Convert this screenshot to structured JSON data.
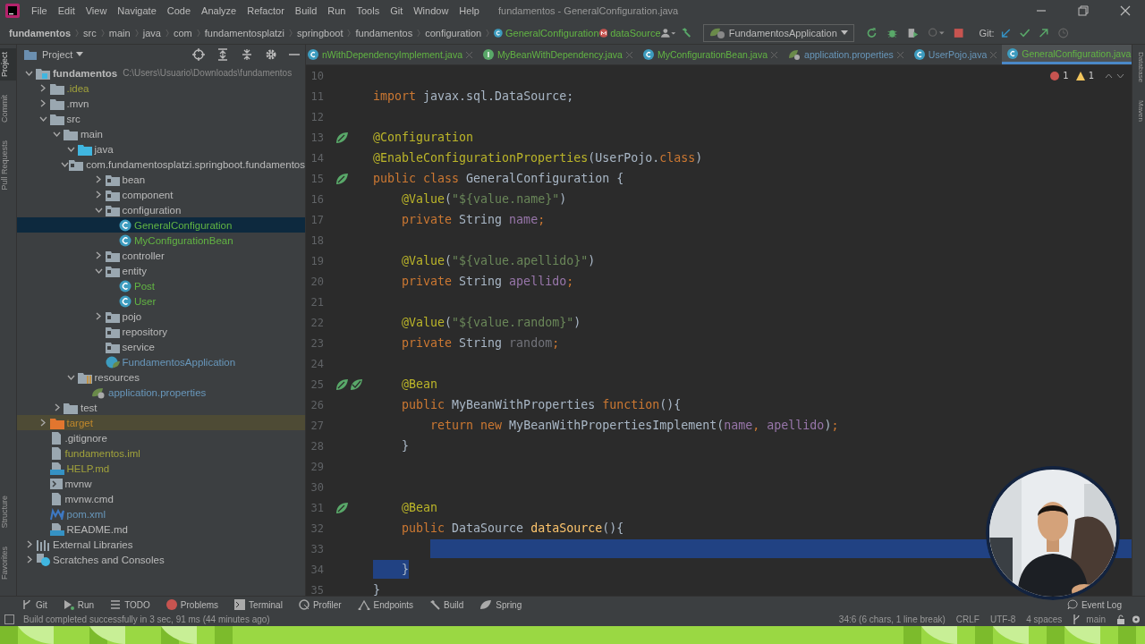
{
  "menu": [
    "File",
    "Edit",
    "View",
    "Navigate",
    "Code",
    "Analyze",
    "Refactor",
    "Build",
    "Run",
    "Tools",
    "Git",
    "Window",
    "Help"
  ],
  "window": {
    "title": "fundamentos - GeneralConfiguration.java"
  },
  "breadcrumbs": [
    {
      "label": "fundamentos",
      "kind": "root"
    },
    {
      "label": "src",
      "kind": "folder"
    },
    {
      "label": "main",
      "kind": "folder"
    },
    {
      "label": "java",
      "kind": "folder"
    },
    {
      "label": "com",
      "kind": "folder"
    },
    {
      "label": "fundamentosplatzi",
      "kind": "folder"
    },
    {
      "label": "springboot",
      "kind": "folder"
    },
    {
      "label": "fundamentos",
      "kind": "folder"
    },
    {
      "label": "configuration",
      "kind": "folder"
    },
    {
      "label": "GeneralConfiguration",
      "kind": "class"
    },
    {
      "label": "dataSource",
      "kind": "method"
    }
  ],
  "run_config": {
    "label": "FundamentosApplication"
  },
  "vcs_label": "Git:",
  "tool_strip_left": [
    {
      "label": "Project",
      "selected": true
    },
    {
      "label": "Commit",
      "selected": false
    },
    {
      "label": "Pull Requests",
      "selected": false
    }
  ],
  "tool_strip_left_bottom": [
    {
      "label": "Structure",
      "selected": false
    },
    {
      "label": "Favorites",
      "selected": false
    }
  ],
  "tool_strip_right": [
    {
      "label": "Database",
      "selected": false
    },
    {
      "label": "Maven",
      "selected": false
    }
  ],
  "project_panel": {
    "title": "Project"
  },
  "tree": [
    {
      "label": "fundamentos",
      "path": "C:\\Users\\Usuario\\Downloads\\fundamentos",
      "kind": "module",
      "color": "#bbbbbb",
      "expanded": true,
      "selected": false,
      "children": [
        {
          "label": ".idea",
          "kind": "folder",
          "color": "#a1a23b",
          "expanded": false,
          "selected": false
        },
        {
          "label": ".mvn",
          "kind": "folder",
          "color": "#bbbbbb",
          "expanded": false,
          "selected": false
        },
        {
          "label": "src",
          "kind": "folder",
          "color": "#bbbbbb",
          "expanded": true,
          "selected": false,
          "children": [
            {
              "label": "main",
              "kind": "folder",
              "color": "#bbbbbb",
              "expanded": true,
              "selected": false,
              "children": [
                {
                  "label": "java",
                  "kind": "source",
                  "color": "#bbbbbb",
                  "expanded": true,
                  "selected": false,
                  "children": [
                    {
                      "label": "com.fundamentosplatzi.springboot.fundamentos",
                      "kind": "package",
                      "color": "#bbbbbb",
                      "expanded": true,
                      "selected": false,
                      "children": [
                        {
                          "label": "bean",
                          "kind": "package",
                          "color": "#bbbbbb",
                          "expanded": false,
                          "selected": false
                        },
                        {
                          "label": "component",
                          "kind": "package",
                          "color": "#bbbbbb",
                          "expanded": false,
                          "selected": false
                        },
                        {
                          "label": "configuration",
                          "kind": "package",
                          "color": "#bbbbbb",
                          "expanded": true,
                          "selected": false,
                          "children": [
                            {
                              "label": "GeneralConfiguration",
                              "kind": "class",
                              "color": "#62b543",
                              "selected": true
                            },
                            {
                              "label": "MyConfigurationBean",
                              "kind": "class",
                              "color": "#62b543",
                              "selected": false
                            }
                          ]
                        },
                        {
                          "label": "controller",
                          "kind": "package",
                          "color": "#bbbbbb",
                          "expanded": false,
                          "selected": false
                        },
                        {
                          "label": "entity",
                          "kind": "package",
                          "color": "#bbbbbb",
                          "expanded": true,
                          "selected": false,
                          "children": [
                            {
                              "label": "Post",
                              "kind": "class",
                              "color": "#62b543",
                              "selected": false
                            },
                            {
                              "label": "User",
                              "kind": "class",
                              "color": "#62b543",
                              "selected": false
                            }
                          ]
                        },
                        {
                          "label": "pojo",
                          "kind": "package",
                          "color": "#bbbbbb",
                          "expanded": false,
                          "selected": false
                        },
                        {
                          "label": "repository",
                          "kind": "package",
                          "color": "#bbbbbb",
                          "selected": false
                        },
                        {
                          "label": "service",
                          "kind": "package",
                          "color": "#bbbbbb",
                          "selected": false
                        },
                        {
                          "label": "FundamentosApplication",
                          "kind": "spring-class",
                          "color": "#6897bb",
                          "selected": false
                        }
                      ]
                    }
                  ]
                },
                {
                  "label": "resources",
                  "kind": "resources",
                  "color": "#bbbbbb",
                  "expanded": true,
                  "selected": false,
                  "children": [
                    {
                      "label": "application.properties",
                      "kind": "properties",
                      "color": "#6897bb",
                      "selected": false
                    }
                  ]
                }
              ]
            },
            {
              "label": "test",
              "kind": "folder",
              "color": "#bbbbbb",
              "expanded": false,
              "selected": false
            }
          ]
        },
        {
          "label": "target",
          "kind": "excluded-folder",
          "color": "#c0882b",
          "expanded": false,
          "selected": false
        },
        {
          "label": ".gitignore",
          "kind": "file",
          "color": "#bbbbbb",
          "selected": false
        },
        {
          "label": "fundamentos.iml",
          "kind": "file",
          "color": "#a1a23b",
          "selected": false
        },
        {
          "label": "HELP.md",
          "kind": "markdown",
          "color": "#a1a23b",
          "selected": false
        },
        {
          "label": "mvnw",
          "kind": "script",
          "color": "#bbbbbb",
          "selected": false
        },
        {
          "label": "mvnw.cmd",
          "kind": "file",
          "color": "#bbbbbb",
          "selected": false
        },
        {
          "label": "pom.xml",
          "kind": "maven",
          "color": "#6897bb",
          "selected": false
        },
        {
          "label": "README.md",
          "kind": "markdown",
          "color": "#bbbbbb",
          "selected": false
        }
      ]
    },
    {
      "label": "External Libraries",
      "kind": "libraries",
      "color": "#bbbbbb",
      "expanded": false,
      "selected": false
    },
    {
      "label": "Scratches and Consoles",
      "kind": "scratches",
      "color": "#bbbbbb",
      "expanded": false,
      "selected": false
    }
  ],
  "editor_tabs": [
    {
      "label": "nWithDependencyImplement.java",
      "kind": "class",
      "color": "#62b543",
      "selected": false
    },
    {
      "label": "MyBeanWithDependency.java",
      "kind": "interface",
      "color": "#62b543",
      "selected": false
    },
    {
      "label": "MyConfigurationBean.java",
      "kind": "class",
      "color": "#62b543",
      "selected": false
    },
    {
      "label": "application.properties",
      "kind": "properties",
      "color": "#6897bb",
      "selected": false
    },
    {
      "label": "UserPojo.java",
      "kind": "class",
      "color": "#6897bb",
      "selected": false
    },
    {
      "label": "GeneralConfiguration.java",
      "kind": "class",
      "color": "#62b543",
      "selected": true
    }
  ],
  "inspections": {
    "errors": "1",
    "warnings": "1"
  },
  "code_lines": [
    {
      "number": "10",
      "kind": "plain"
    },
    {
      "number": "11",
      "kind": "plain",
      "segments": [
        {
          "text": "import",
          "kind": "keyword"
        },
        {
          "text": " javax.sql.DataSource;",
          "kind": "plain"
        }
      ]
    },
    {
      "number": "12",
      "kind": "plain"
    },
    {
      "number": "13",
      "kind": "bean",
      "segments": [
        {
          "text": "@Configuration",
          "kind": "annotation"
        }
      ]
    },
    {
      "number": "14",
      "kind": "plain",
      "segments": [
        {
          "text": "@EnableConfigurationProperties",
          "kind": "annotation"
        },
        {
          "text": "(UserPojo.",
          "kind": "plain"
        },
        {
          "text": "class",
          "kind": "keyword"
        },
        {
          "text": ")",
          "kind": "plain"
        }
      ]
    },
    {
      "number": "15",
      "kind": "bean",
      "segments": [
        {
          "text": "public class",
          "kind": "keyword"
        },
        {
          "text": " GeneralConfiguration {",
          "kind": "plain"
        }
      ]
    },
    {
      "number": "16",
      "kind": "plain",
      "segments": [
        {
          "text": "    @Value",
          "kind": "annotation"
        },
        {
          "text": "(",
          "kind": "plain"
        },
        {
          "text": "\"${value.name}\"",
          "kind": "string"
        },
        {
          "text": ")",
          "kind": "plain"
        }
      ]
    },
    {
      "number": "17",
      "kind": "plain",
      "segments": [
        {
          "text": "    private",
          "kind": "keyword"
        },
        {
          "text": " String ",
          "kind": "plain"
        },
        {
          "text": "name",
          "kind": "field"
        },
        {
          "text": ";",
          "kind": "keyword"
        }
      ]
    },
    {
      "number": "18",
      "kind": "plain"
    },
    {
      "number": "19",
      "kind": "plain",
      "segments": [
        {
          "text": "    @Value",
          "kind": "annotation"
        },
        {
          "text": "(",
          "kind": "plain"
        },
        {
          "text": "\"${value.apellido}\"",
          "kind": "string"
        },
        {
          "text": ")",
          "kind": "plain"
        }
      ]
    },
    {
      "number": "20",
      "kind": "plain",
      "segments": [
        {
          "text": "    private",
          "kind": "keyword"
        },
        {
          "text": " String ",
          "kind": "plain"
        },
        {
          "text": "apellido",
          "kind": "field"
        },
        {
          "text": ";",
          "kind": "keyword"
        }
      ]
    },
    {
      "number": "21",
      "kind": "plain"
    },
    {
      "number": "22",
      "kind": "plain",
      "segments": [
        {
          "text": "    @Value",
          "kind": "annotation"
        },
        {
          "text": "(",
          "kind": "plain"
        },
        {
          "text": "\"${value.random}\"",
          "kind": "string"
        },
        {
          "text": ")",
          "kind": "plain"
        }
      ]
    },
    {
      "number": "23",
      "kind": "plain",
      "segments": [
        {
          "text": "    private",
          "kind": "keyword"
        },
        {
          "text": " String ",
          "kind": "plain"
        },
        {
          "text": "random",
          "kind": "unused"
        },
        {
          "text": ";",
          "kind": "keyword"
        }
      ]
    },
    {
      "number": "24",
      "kind": "plain"
    },
    {
      "number": "25",
      "kind": "bean-pair",
      "segments": [
        {
          "text": "    @Bean",
          "kind": "annotation"
        }
      ]
    },
    {
      "number": "26",
      "kind": "plain",
      "segments": [
        {
          "text": "    public",
          "kind": "keyword"
        },
        {
          "text": " MyBeanWithProperties ",
          "kind": "plain"
        },
        {
          "text": "function",
          "kind": "keyword"
        },
        {
          "text": "(){",
          "kind": "plain"
        }
      ]
    },
    {
      "number": "27",
      "kind": "plain",
      "segments": [
        {
          "text": "        return new",
          "kind": "keyword"
        },
        {
          "text": " MyBeanWithPropertiesImplement(",
          "kind": "plain"
        },
        {
          "text": "name",
          "kind": "field"
        },
        {
          "text": ", ",
          "kind": "keyword"
        },
        {
          "text": "apellido",
          "kind": "field"
        },
        {
          "text": ")",
          "kind": "plain"
        },
        {
          "text": ";",
          "kind": "keyword"
        }
      ]
    },
    {
      "number": "28",
      "kind": "plain",
      "segments": [
        {
          "text": "    }",
          "kind": "plain"
        }
      ]
    },
    {
      "number": "29",
      "kind": "plain"
    },
    {
      "number": "30",
      "kind": "plain"
    },
    {
      "number": "31",
      "kind": "bean",
      "segments": [
        {
          "text": "    @Bean",
          "kind": "annotation"
        }
      ]
    },
    {
      "number": "32",
      "kind": "plain",
      "segments": [
        {
          "text": "    public",
          "kind": "keyword"
        },
        {
          "text": " DataSource ",
          "kind": "plain"
        },
        {
          "text": "dataSource",
          "kind": "method"
        },
        {
          "text": "(){",
          "kind": "plain"
        }
      ]
    },
    {
      "number": "33",
      "kind": "selected-to-end"
    },
    {
      "number": "34",
      "kind": "selected-text",
      "segments": [
        {
          "text": "    }",
          "kind": "plain"
        }
      ]
    },
    {
      "number": "35",
      "kind": "plain",
      "segments": [
        {
          "text": "}",
          "kind": "plain"
        }
      ]
    }
  ],
  "tool_windows": [
    {
      "label": "Git",
      "kind": "git"
    },
    {
      "label": "Run",
      "kind": "run"
    },
    {
      "label": "TODO",
      "kind": "todo"
    },
    {
      "label": "Problems",
      "kind": "problems"
    },
    {
      "label": "Terminal",
      "kind": "terminal"
    },
    {
      "label": "Profiler",
      "kind": "profiler"
    },
    {
      "label": "Endpoints",
      "kind": "endpoints"
    },
    {
      "label": "Build",
      "kind": "build"
    },
    {
      "label": "Spring",
      "kind": "spring"
    }
  ],
  "event_log": "Event Log",
  "status_bar": {
    "message": "Build completed successfully in 3 sec, 91 ms (44 minutes ago)",
    "items": [
      "34:6 (6 chars, 1 line break)",
      "CRLF",
      "UTF-8",
      "4 spaces"
    ],
    "branch": "main"
  }
}
